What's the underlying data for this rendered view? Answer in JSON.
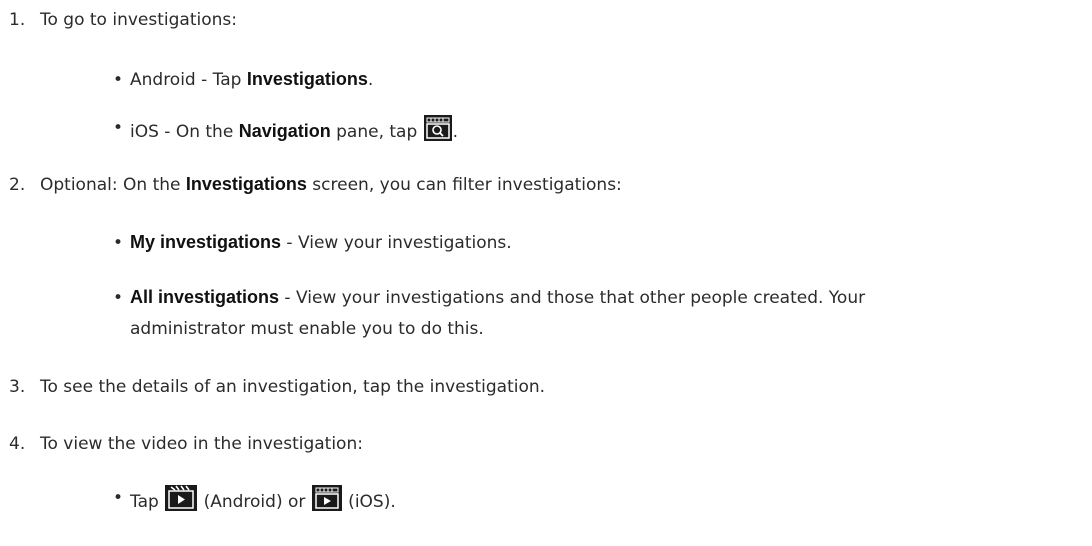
{
  "steps": [
    {
      "num": "1.",
      "text": "To go to investigations:"
    },
    {
      "num": "2.",
      "text_pre": "Optional: On the ",
      "bold": "Investigations",
      "text_post": " screen, you can filter investigations:"
    },
    {
      "num": "3.",
      "text": "To see the details of an investigation, tap the investigation."
    },
    {
      "num": "4.",
      "text": "To view the video in the investigation:"
    }
  ],
  "step1_bullets": {
    "android": {
      "pre": "Android - Tap ",
      "bold": "Investigations",
      "post": "."
    },
    "ios": {
      "pre": "iOS - On the ",
      "bold": "Navigation",
      "mid": " pane, tap ",
      "post": ".",
      "icon": "investigations-icon"
    }
  },
  "step2_bullets": {
    "mine": {
      "bold": "My investigations",
      "post": " - View your investigations."
    },
    "all": {
      "bold": "All investigations",
      "post": " - View your investigations and those that other people created. Your",
      "line2": "administrator must enable you to do this."
    }
  },
  "step4_bullets": {
    "play": {
      "pre": "Tap ",
      "mid": " (Android) or ",
      "post": " (iOS).",
      "icon_android": "video-play-icon-android",
      "icon_ios": "video-play-icon-ios"
    }
  },
  "colors": {
    "text": "#2b2b2b",
    "icon_bg": "#1a1a1a",
    "icon_fg": "#ffffff"
  }
}
